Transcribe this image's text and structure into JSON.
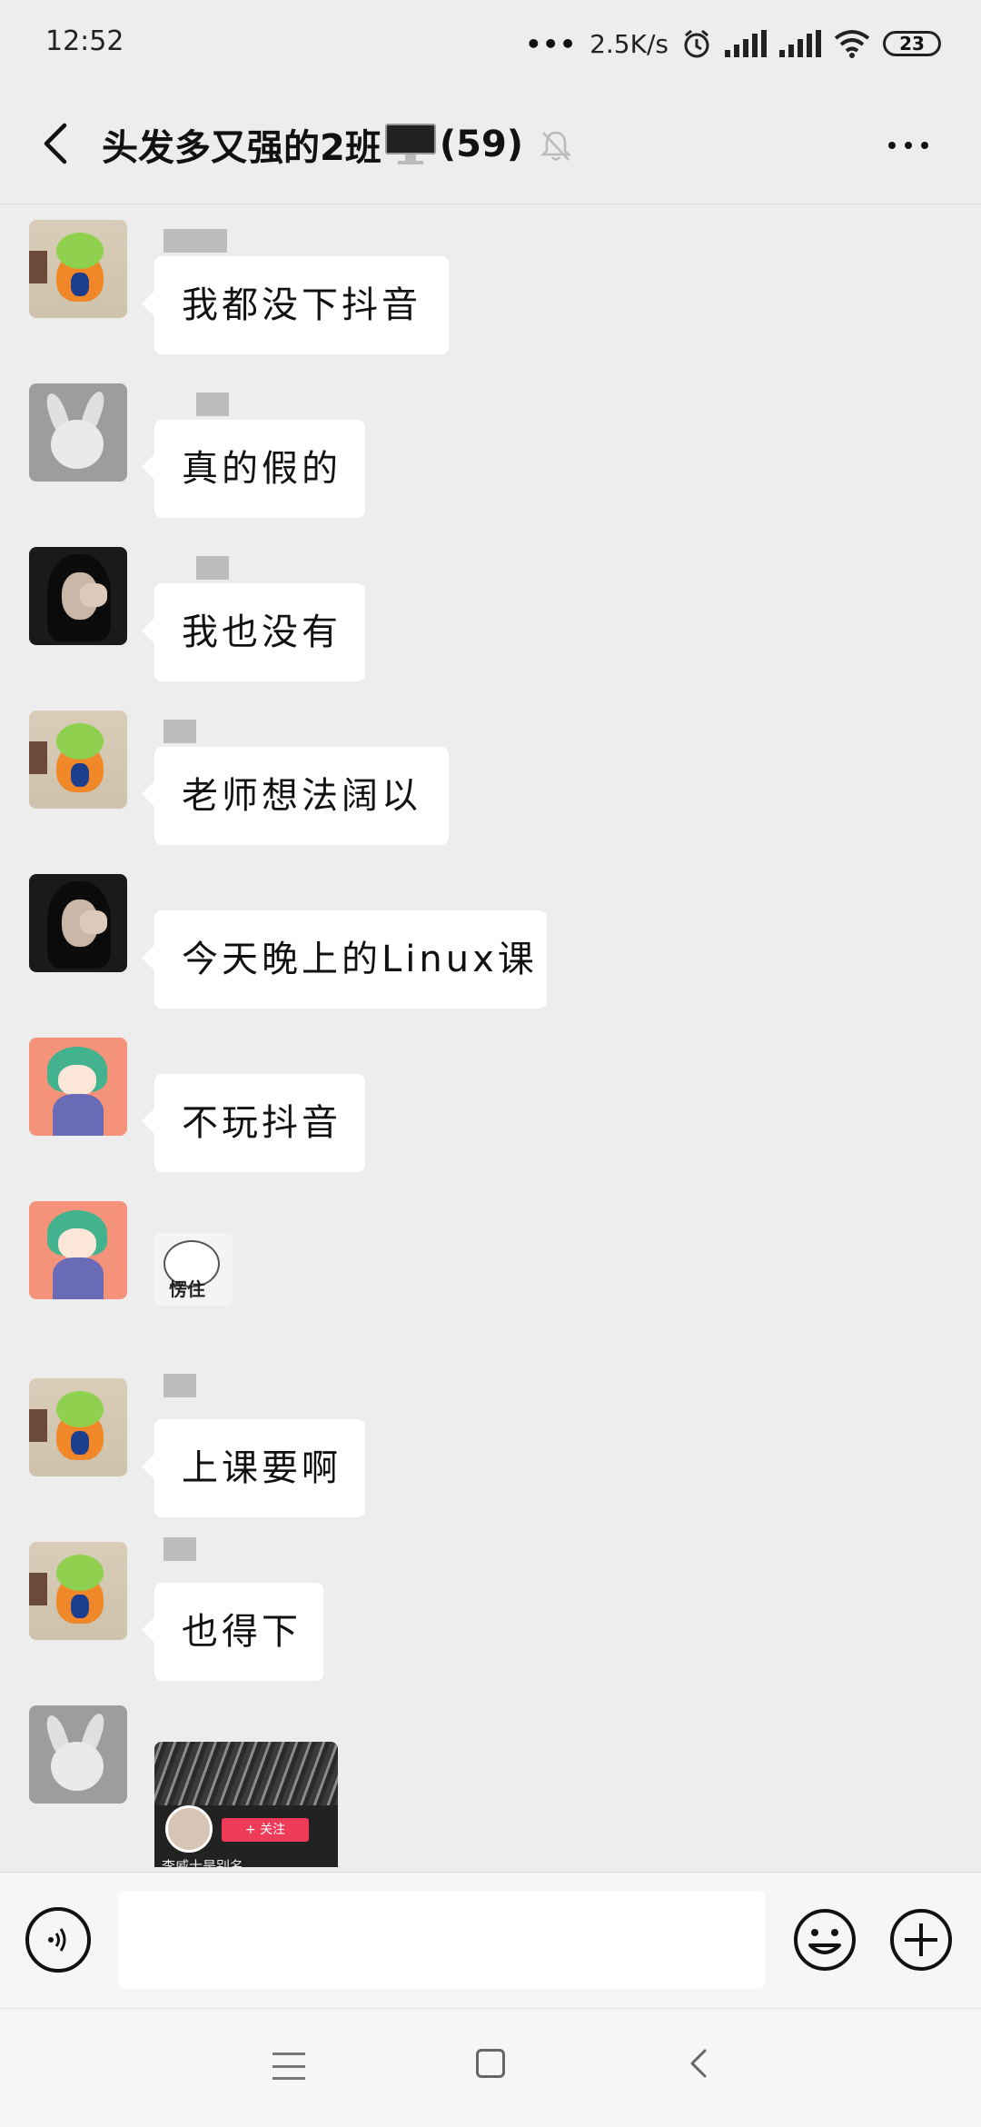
{
  "status_bar": {
    "time": "12:52",
    "net_speed": "2.5K/s",
    "battery": "23",
    "icons": [
      "more-dots-icon",
      "alarm-icon",
      "hd-signal-icon",
      "signal-icon",
      "wifi-icon",
      "battery-icon"
    ]
  },
  "header": {
    "title_part1": "头发多又强的2班",
    "title_part2": "(59)",
    "icons": [
      "back-arrow-icon",
      "monitor-emoji-icon",
      "mute-bell-icon",
      "more-options-icon"
    ]
  },
  "messages": [
    {
      "type": "text",
      "text": "我都没下抖音",
      "avatar": "dino"
    },
    {
      "type": "text",
      "text": "真的假的",
      "avatar": "pika"
    },
    {
      "type": "text",
      "text": "我也没有",
      "avatar": "girl"
    },
    {
      "type": "text",
      "text": "老师想法阔以",
      "avatar": "dino"
    },
    {
      "type": "text",
      "text": "今天晚上的Linux课",
      "avatar": "girl"
    },
    {
      "type": "text",
      "text": "不玩抖音",
      "avatar": "green"
    },
    {
      "type": "sticker",
      "text": "愣住",
      "avatar": "green"
    },
    {
      "type": "text",
      "text": "上课要啊",
      "avatar": "dino"
    },
    {
      "type": "text",
      "text": "也得下",
      "avatar": "dino"
    },
    {
      "type": "share_card",
      "text": "李威士是别名",
      "button": "+ 关注",
      "avatar": "pika"
    }
  ],
  "input_bar": {
    "placeholder": "",
    "icons": [
      "voice-icon",
      "emoji-icon",
      "plus-icon"
    ]
  },
  "nav_bar": {
    "icons": [
      "menu-icon",
      "home-icon",
      "back-icon"
    ]
  }
}
